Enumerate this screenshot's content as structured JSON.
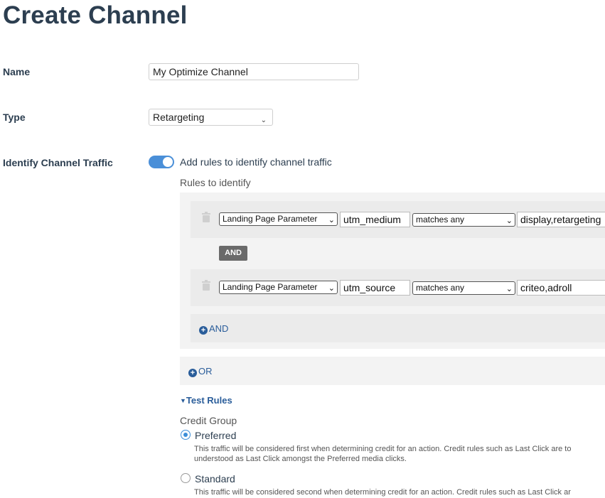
{
  "page": {
    "title": "Create Channel"
  },
  "name_field": {
    "label": "Name",
    "value": "My Optimize Channel"
  },
  "type_field": {
    "label": "Type",
    "value": "Retargeting",
    "caret_icon": "chevron-down-icon"
  },
  "identify": {
    "label": "Identify Channel Traffic",
    "toggle_label": "Add rules to identify channel traffic",
    "toggle_on": true,
    "rules_heading": "Rules to identify",
    "rules": [
      {
        "parameter": "Landing Page Parameter",
        "key": "utm_medium",
        "operator": "matches any",
        "value": "display,retargeting"
      },
      {
        "parameter": "Landing Page Parameter",
        "key": "utm_source",
        "operator": "matches any",
        "value": "criteo,adroll"
      }
    ],
    "and_badge": "AND",
    "add_and": "AND",
    "add_or": "OR"
  },
  "test_rules": {
    "label": "Test Rules"
  },
  "credit_group": {
    "label": "Credit Group",
    "options": [
      {
        "label": "Preferred",
        "checked": true,
        "description_line1": "This traffic will be considered first when determining credit for an action. Credit rules such as Last Click are to",
        "description_line2": "understood as Last Click amongst the Preferred media clicks."
      },
      {
        "label": "Standard",
        "checked": false,
        "description_line1": "This traffic will be considered second when determining credit for an action. Credit rules such as Last Click ar"
      }
    ]
  },
  "colors": {
    "accent": "#4a8fd8",
    "link": "#2a5d9a",
    "title": "#2c3e50"
  }
}
